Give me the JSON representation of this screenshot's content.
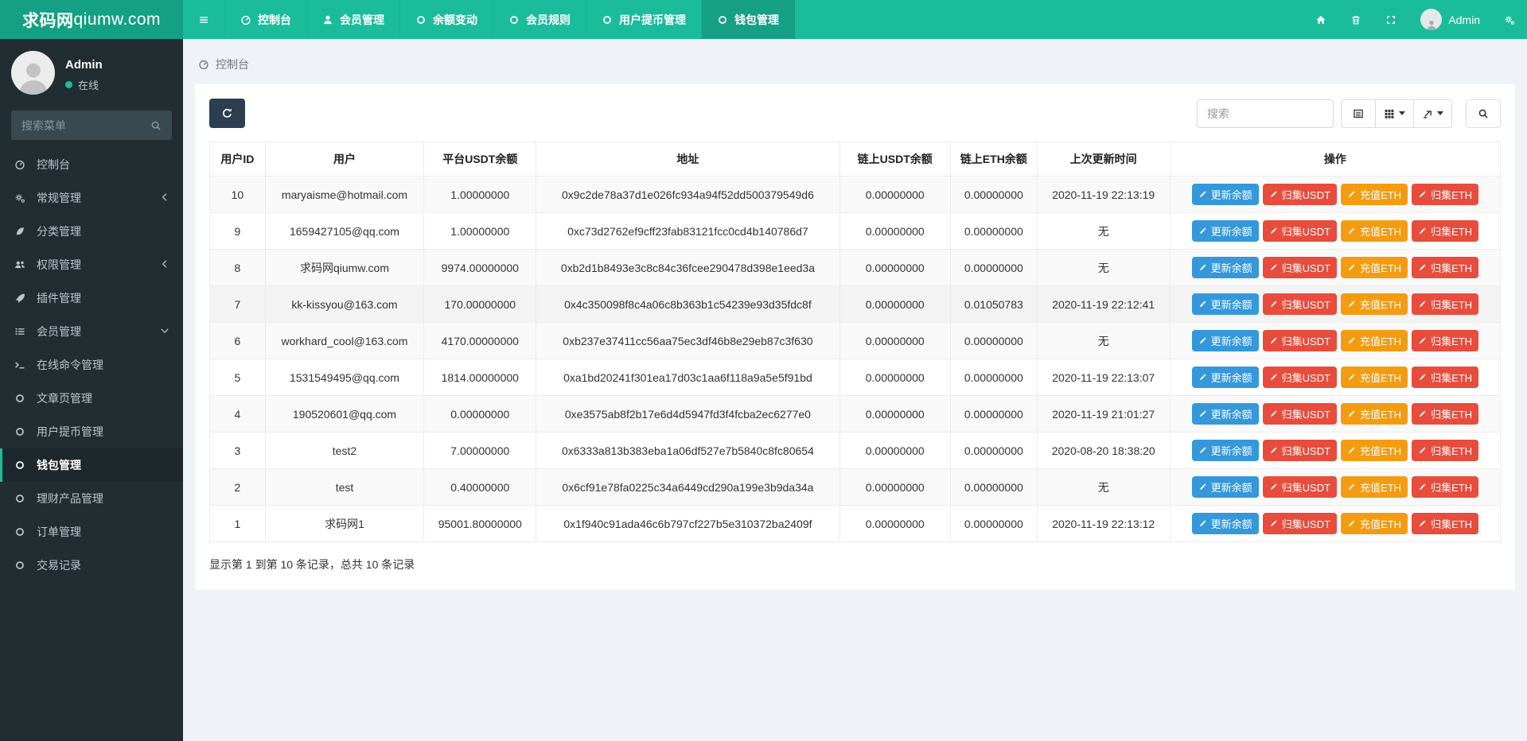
{
  "topnav": {
    "brand_bold": "求码网",
    "brand_rest": "qiumw.com",
    "items": [
      {
        "key": "console",
        "label": "控制台",
        "icon": "dashboard-icon",
        "active": false
      },
      {
        "key": "members",
        "label": "会员管理",
        "icon": "user-icon",
        "active": false
      },
      {
        "key": "balance-change",
        "label": "余额变动",
        "icon": "circle-icon",
        "active": false
      },
      {
        "key": "member-rules",
        "label": "会员规则",
        "icon": "circle-icon",
        "active": false
      },
      {
        "key": "withdraw",
        "label": "用户提币管理",
        "icon": "circle-icon",
        "active": false
      },
      {
        "key": "wallet",
        "label": "钱包管理",
        "icon": "circle-icon",
        "active": true
      }
    ],
    "right_icons": [
      "home-icon",
      "trash-icon",
      "expand-icon"
    ],
    "user_label": "Admin",
    "settings_icon": "gears-icon"
  },
  "sidebar": {
    "user_name": "Admin",
    "user_status": "在线",
    "search_placeholder": "搜索菜单",
    "items": [
      {
        "key": "console",
        "label": "控制台",
        "icon": "dashboard-icon",
        "chevron": "",
        "active": false
      },
      {
        "key": "general",
        "label": "常规管理",
        "icon": "gears-icon",
        "chevron": "left",
        "active": false
      },
      {
        "key": "category",
        "label": "分类管理",
        "icon": "leaf-icon",
        "chevron": "",
        "active": false
      },
      {
        "key": "auth",
        "label": "权限管理",
        "icon": "users-icon",
        "chevron": "left",
        "active": false
      },
      {
        "key": "addon",
        "label": "插件管理",
        "icon": "rocket-icon",
        "chevron": "",
        "active": false
      },
      {
        "key": "members",
        "label": "会员管理",
        "icon": "list-icon",
        "chevron": "down",
        "active": false
      },
      {
        "key": "command",
        "label": "在线命令管理",
        "icon": "terminal-icon",
        "chevron": "",
        "active": false
      },
      {
        "key": "article",
        "label": "文章页管理",
        "icon": "circle-icon",
        "chevron": "",
        "active": false
      },
      {
        "key": "withdraw",
        "label": "用户提币管理",
        "icon": "circle-icon",
        "chevron": "",
        "active": false
      },
      {
        "key": "wallet",
        "label": "钱包管理",
        "icon": "circle-icon",
        "chevron": "",
        "active": true
      },
      {
        "key": "finance-product",
        "label": "理财产品管理",
        "icon": "circle-icon",
        "chevron": "",
        "active": false
      },
      {
        "key": "orders",
        "label": "订单管理",
        "icon": "circle-icon",
        "chevron": "",
        "active": false
      },
      {
        "key": "transactions",
        "label": "交易记录",
        "icon": "circle-icon",
        "chevron": "",
        "active": false
      }
    ]
  },
  "breadcrumb": {
    "icon": "dashboard-icon",
    "label": "控制台"
  },
  "toolbar": {
    "refresh_icon": "refresh-icon",
    "search_placeholder": "搜索",
    "group_buttons": [
      {
        "name": "toggle-view-button",
        "icon": "detail-view-icon",
        "caret": false
      },
      {
        "name": "columns-button",
        "icon": "columns-icon",
        "caret": true
      },
      {
        "name": "export-button",
        "icon": "export-icon",
        "caret": true
      }
    ],
    "search_button_icon": "search-icon"
  },
  "table": {
    "columns": [
      "用户ID",
      "用户",
      "平台USDT余额",
      "地址",
      "链上USDT余额",
      "链上ETH余额",
      "上次更新时间",
      "操作"
    ],
    "rows": [
      {
        "cells": [
          "10",
          "maryaisme@hotmail.com",
          "1.00000000",
          "0x9c2de78a37d1e026fc934a94f52dd500379549d6",
          "0.00000000",
          "0.00000000",
          "2020-11-19 22:13:19"
        ],
        "hovered": false
      },
      {
        "cells": [
          "9",
          "1659427105@qq.com",
          "1.00000000",
          "0xc73d2762ef9cff23fab83121fcc0cd4b140786d7",
          "0.00000000",
          "0.00000000",
          "无"
        ],
        "hovered": false
      },
      {
        "cells": [
          "8",
          "求码网qiumw.com",
          "9974.00000000",
          "0xb2d1b8493e3c8c84c36fcee290478d398e1eed3a",
          "0.00000000",
          "0.00000000",
          "无"
        ],
        "hovered": false
      },
      {
        "cells": [
          "7",
          "kk-kissyou@163.com",
          "170.00000000",
          "0x4c350098f8c4a06c8b363b1c54239e93d35fdc8f",
          "0.00000000",
          "0.01050783",
          "2020-11-19 22:12:41"
        ],
        "hovered": true
      },
      {
        "cells": [
          "6",
          "workhard_cool@163.com",
          "4170.00000000",
          "0xb237e37411cc56aa75ec3df46b8e29eb87c3f630",
          "0.00000000",
          "0.00000000",
          "无"
        ],
        "hovered": false
      },
      {
        "cells": [
          "5",
          "1531549495@qq.com",
          "1814.00000000",
          "0xa1bd20241f301ea17d03c1aa6f118a9a5e5f91bd",
          "0.00000000",
          "0.00000000",
          "2020-11-19 22:13:07"
        ],
        "hovered": false
      },
      {
        "cells": [
          "4",
          "190520601@qq.com",
          "0.00000000",
          "0xe3575ab8f2b17e6d4d5947fd3f4fcba2ec6277e0",
          "0.00000000",
          "0.00000000",
          "2020-11-19 21:01:27"
        ],
        "hovered": false
      },
      {
        "cells": [
          "3",
          "test2",
          "7.00000000",
          "0x6333a813b383eba1a06df527e7b5840c8fc80654",
          "0.00000000",
          "0.00000000",
          "2020-08-20 18:38:20"
        ],
        "hovered": false
      },
      {
        "cells": [
          "2",
          "test",
          "0.40000000",
          "0x6cf91e78fa0225c34a6449cd290a199e3b9da34a",
          "0.00000000",
          "0.00000000",
          "无"
        ],
        "hovered": false
      },
      {
        "cells": [
          "1",
          "求码网1",
          "95001.80000000",
          "0x1f940c91ada46c6b797cf227b5e310372ba2409f",
          "0.00000000",
          "0.00000000",
          "2020-11-19 22:13:12"
        ]
      }
    ],
    "row_actions": [
      {
        "key": "update-balance",
        "label": "更新余额",
        "color": "#3498db",
        "icon": "pencil-icon"
      },
      {
        "key": "collect-usdt",
        "label": "归集USDT",
        "color": "#e74c3c",
        "icon": "pencil-icon"
      },
      {
        "key": "recharge-eth",
        "label": "充值ETH",
        "color": "#f39c12",
        "icon": "pencil-icon"
      },
      {
        "key": "collect-eth",
        "label": "归集ETH",
        "color": "#e74c3c",
        "icon": "pencil-icon"
      }
    ],
    "summary": "显示第 1 到第 10 条记录，总共 10 条记录"
  },
  "colors": {
    "navbar": "#1abc9c",
    "brand_bg": "#14a084",
    "navbar_active": "#16a085",
    "sidebar_bg": "#222d32",
    "sidebar_active_border": "#1abc9c",
    "refresh_button": "#2c3e50",
    "button_blue": "#3498db",
    "button_red": "#e74c3c",
    "button_orange": "#f39c12",
    "status_dot": "#18bc9c"
  }
}
